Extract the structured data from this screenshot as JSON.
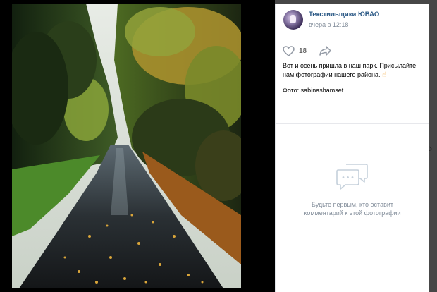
{
  "post": {
    "author": "Текстильщики ЮВАО",
    "time": "вчера в 12:18",
    "likes": "18",
    "caption": "Вот и осень пришла в наш парк. Присылайте нам фотографии нашего района.",
    "caption_emoji": "☝",
    "credit": "Фото: sabinashamset"
  },
  "comments": {
    "empty_line1": "Будьте первым, кто оставит",
    "empty_line2": "комментарий к этой фотографии"
  },
  "icons": {
    "like": "heart-outline-icon",
    "share": "share-arrow-icon",
    "comments": "speech-bubbles-icon"
  },
  "colors": {
    "author_link": "#2a5885",
    "meta_gray": "#818c99",
    "backdrop": "#474747"
  }
}
